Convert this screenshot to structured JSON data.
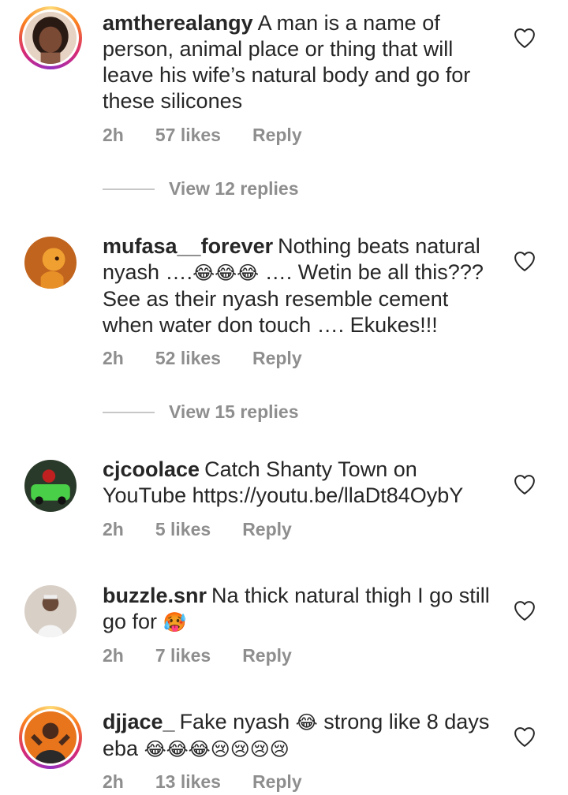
{
  "comments": [
    {
      "username": "amtherealangy",
      "text": "A man is a name of person, animal place or thing that will leave his wife’s natural body and go for these silicones",
      "time": "2h",
      "likes": "57 likes",
      "reply": "Reply",
      "view_replies": "View 12 replies"
    },
    {
      "username": "mufasa__forever",
      "text_a": "Nothing beats natural nyash ….",
      "emojis": "😂😂😂",
      "text_b": " …. Wetin be all this??? See as their nyash resemble cement when water don touch …. Ekukes!!!",
      "time": "2h",
      "likes": "52 likes",
      "reply": "Reply",
      "view_replies": "View 15 replies"
    },
    {
      "username": "cjcoolace",
      "text": "Catch Shanty Town on YouTube https://youtu.be/llaDt84OybY",
      "time": "2h",
      "likes": "5 likes",
      "reply": "Reply"
    },
    {
      "username": "buzzle.snr",
      "text": "Na thick natural thigh I go still go for",
      "emoji": "🥵",
      "time": "2h",
      "likes": "7 likes",
      "reply": "Reply"
    },
    {
      "username": "djjace_",
      "text_a": "Fake nyash",
      "emoji_a": "😂",
      "text_b": "strong like 8 days eba",
      "emoji_b": "😂😂😂😢😢😢😢",
      "time": "2h",
      "likes": "13 likes",
      "reply": "Reply"
    }
  ],
  "icons": {
    "like": "heart-outline-icon"
  },
  "colors": {
    "text": "#262626",
    "meta": "#8e8e8e",
    "divider": "#c7c7c7"
  }
}
